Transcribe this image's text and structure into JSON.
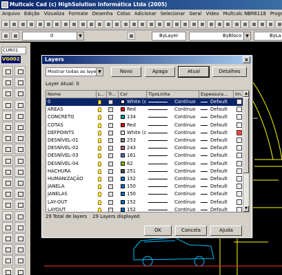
{
  "window": {
    "title": "Multcalc Cad (c) HighSolution Informática Ltda (2005)"
  },
  "menu": [
    "Arquivo",
    "Edição",
    "Vizualiza",
    "Formate",
    "Desenha",
    "Cotas",
    "Adicionar",
    "Selecionar",
    "Geral",
    "Video",
    "Multcalc NBR6118",
    "Progr"
  ],
  "toolbar": {
    "layer_combo": "0",
    "color_combo": "ByLayer",
    "linetype_combo": "ByBloco",
    "lineweight_combo": "ByLa"
  },
  "left": {
    "cursor_combo": "CUR01",
    "view_label": "VG002"
  },
  "dialog": {
    "title": "Layers",
    "close_label": "x",
    "filter_value": "Mostrar todas as layers",
    "buttons": {
      "new": "Novo",
      "delete": "Apaga",
      "current": "Atual",
      "details": "Detalhes"
    },
    "current_layer_label": "Layer Atual:",
    "current_layer_value": "0",
    "columns": [
      "Nome",
      "L...",
      "Tr...",
      "Cor",
      "TipoLinha",
      "Espessura...",
      "Im..."
    ],
    "rows": [
      {
        "name": "0",
        "color_name": "White (c...",
        "color": "#ffffff",
        "linetype": "Contínuo",
        "weight": "Default",
        "selected": true,
        "print_red": false
      },
      {
        "name": "AREAS",
        "color_name": "Red",
        "color": "#ff0000",
        "linetype": "Contínuo",
        "weight": "Default",
        "selected": false,
        "print_red": false
      },
      {
        "name": "CONCRETO",
        "color_name": "134",
        "color": "#00a0a0",
        "linetype": "Contínuo",
        "weight": "Default",
        "selected": false,
        "print_red": false
      },
      {
        "name": "COTAS",
        "color_name": "Red",
        "color": "#ff0000",
        "linetype": "Contínuo",
        "weight": "Default",
        "selected": false,
        "print_red": false
      },
      {
        "name": "DEFPOINTS",
        "color_name": "White (c...",
        "color": "#ffffff",
        "linetype": "Contínuo",
        "weight": "Default",
        "selected": false,
        "print_red": true
      },
      {
        "name": "DESNÍVEL-01",
        "color_name": "253",
        "color": "#909090",
        "linetype": "Contínuo",
        "weight": "Default",
        "selected": false,
        "print_red": false
      },
      {
        "name": "DESNÍVEL-02",
        "color_name": "243",
        "color": "#c06080",
        "linetype": "Contínuo",
        "weight": "Default",
        "selected": false,
        "print_red": false
      },
      {
        "name": "DESNÍVEL-03",
        "color_name": "161",
        "color": "#5070c0",
        "linetype": "Contínuo",
        "weight": "Default",
        "selected": false,
        "print_red": false
      },
      {
        "name": "DESNÍVEL-04",
        "color_name": "62",
        "color": "#80c000",
        "linetype": "Contínuo",
        "weight": "Default",
        "selected": false,
        "print_red": false
      },
      {
        "name": "HACHURA",
        "color_name": "251",
        "color": "#505050",
        "linetype": "Contínuo",
        "weight": "Default",
        "selected": false,
        "print_red": false
      },
      {
        "name": "HUMANIZAÇÃO",
        "color_name": "152",
        "color": "#0070c0",
        "linetype": "Contínuo",
        "weight": "Default",
        "selected": false,
        "print_red": false
      },
      {
        "name": "JANELA",
        "color_name": "150",
        "color": "#0070d8",
        "linetype": "Contínuo",
        "weight": "Default",
        "selected": false,
        "print_red": false
      },
      {
        "name": "JANELAS",
        "color_name": "150",
        "color": "#0070d8",
        "linetype": "Contínuo",
        "weight": "Default",
        "selected": false,
        "print_red": false
      },
      {
        "name": "LAY-OUT",
        "color_name": "152",
        "color": "#0070c0",
        "linetype": "Contínuo",
        "weight": "Default",
        "selected": false,
        "print_red": false
      },
      {
        "name": "LAYOUT",
        "color_name": "152",
        "color": "#0070c0",
        "linetype": "Contínuo",
        "weight": "Default",
        "selected": false,
        "print_red": false
      }
    ],
    "status_total": "29 Total de layers",
    "status_displayed": "29 Layers displayed",
    "footer": {
      "ok": "OK",
      "cancel": "Cancela",
      "help": "Ajuda"
    }
  }
}
